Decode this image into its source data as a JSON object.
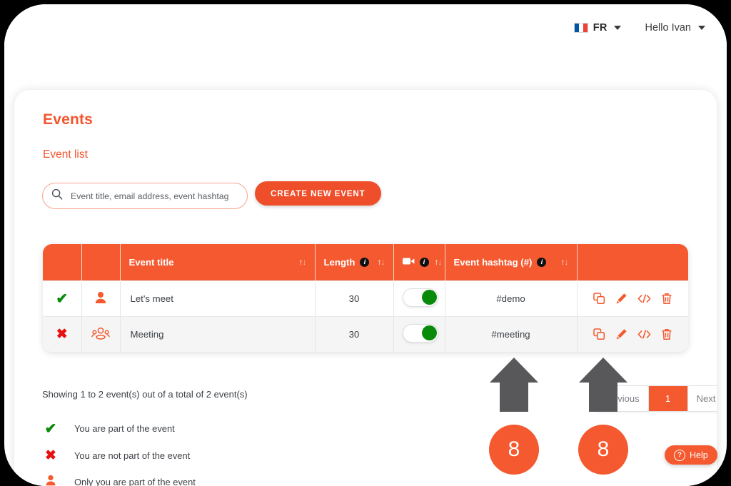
{
  "header": {
    "language": {
      "code": "FR",
      "flag_icon": "flag-fr-icon"
    },
    "user_greeting": "Hello Ivan"
  },
  "page": {
    "title": "Events",
    "section_title": "Event list"
  },
  "search": {
    "placeholder": "Event title, email address, event hashtag",
    "value": "",
    "icon": "search-icon"
  },
  "buttons": {
    "create_new_event": "CREATE NEW EVENT",
    "help": "Help"
  },
  "table": {
    "columns": [
      {
        "key": "participation",
        "label": "",
        "info": false,
        "sortable": false
      },
      {
        "key": "attendees",
        "label": "",
        "info": false,
        "sortable": false
      },
      {
        "key": "title",
        "label": "Event title",
        "info": false,
        "sortable": true
      },
      {
        "key": "length",
        "label": "Length",
        "info": true,
        "sortable": true
      },
      {
        "key": "video",
        "label": "",
        "icon": "video-camera-icon",
        "info": true,
        "sortable": true
      },
      {
        "key": "hashtag",
        "label": "Event hashtag (#)",
        "info": true,
        "sortable": true
      },
      {
        "key": "actions",
        "label": "",
        "info": false,
        "sortable": false
      }
    ],
    "rows": [
      {
        "participation": "check",
        "attendees_icon": "single-person-icon",
        "title": "Let's meet",
        "length": "30",
        "video_enabled": true,
        "hashtag": "#demo",
        "actions": [
          "duplicate-icon",
          "edit-icon",
          "embed-code-icon",
          "delete-icon"
        ]
      },
      {
        "participation": "cross",
        "attendees_icon": "group-people-icon",
        "title": "Meeting",
        "length": "30",
        "video_enabled": true,
        "hashtag": "#meeting",
        "actions": [
          "duplicate-icon",
          "edit-icon",
          "embed-code-icon",
          "delete-icon"
        ]
      }
    ]
  },
  "footer": {
    "showing_text": "Showing 1 to 2 event(s) out of a total of 2 event(s)",
    "legend": [
      {
        "icon": "check",
        "text": "You are part of the event"
      },
      {
        "icon": "cross",
        "text": "You are not part of the event"
      },
      {
        "icon": "person",
        "text": "Only you are part of the event"
      }
    ]
  },
  "pagination": {
    "previous": "Previous",
    "pages": [
      "1"
    ],
    "active_page": "1",
    "next": "Next"
  },
  "annotations": [
    {
      "label": "8",
      "target": "table-actions-column"
    },
    {
      "label": "8",
      "target": "pagination"
    }
  ],
  "colors": {
    "brand_orange": "#F4592F",
    "button_orange": "#EF4E2B",
    "green": "#0A8A0A",
    "red": "#E81010",
    "annotation_gray": "#58585A"
  }
}
